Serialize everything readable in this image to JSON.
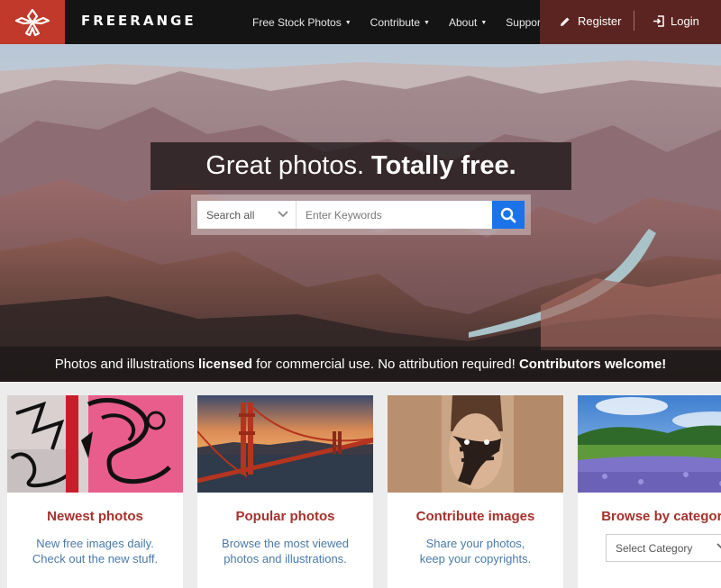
{
  "header": {
    "brand": "FREERANGE",
    "nav": [
      {
        "label": "Free Stock Photos"
      },
      {
        "label": "Contribute"
      },
      {
        "label": "About"
      },
      {
        "label": "Support"
      }
    ],
    "register_label": "Register",
    "login_label": "Login",
    "logo_color": "#c0392b",
    "account_bg": "#5b2421"
  },
  "hero": {
    "headline_regular": "Great photos.",
    "headline_bold": "Totally free.",
    "search": {
      "scope_value": "Search all",
      "placeholder": "Enter Keywords",
      "button_color": "#1a73e8"
    },
    "tagline": {
      "part1": "Photos and illustrations ",
      "bold1": "licensed",
      "part2": " for commercial use. No attribution required! ",
      "bold2": "Contributors welcome!"
    }
  },
  "cards": [
    {
      "title": "Newest photos",
      "line1": "New free images daily.",
      "line2": "Check out the new stuff."
    },
    {
      "title": "Popular photos",
      "line1": "Browse the most viewed",
      "line2": "photos and illustrations."
    },
    {
      "title": "Contribute images",
      "line1": "Share your photos,",
      "line2": "keep your copyrights."
    },
    {
      "title": "Browse by category",
      "select_value": "Select Category"
    }
  ],
  "colors": {
    "accent_red": "#a5322c",
    "link_blue": "#4a7aa8"
  }
}
